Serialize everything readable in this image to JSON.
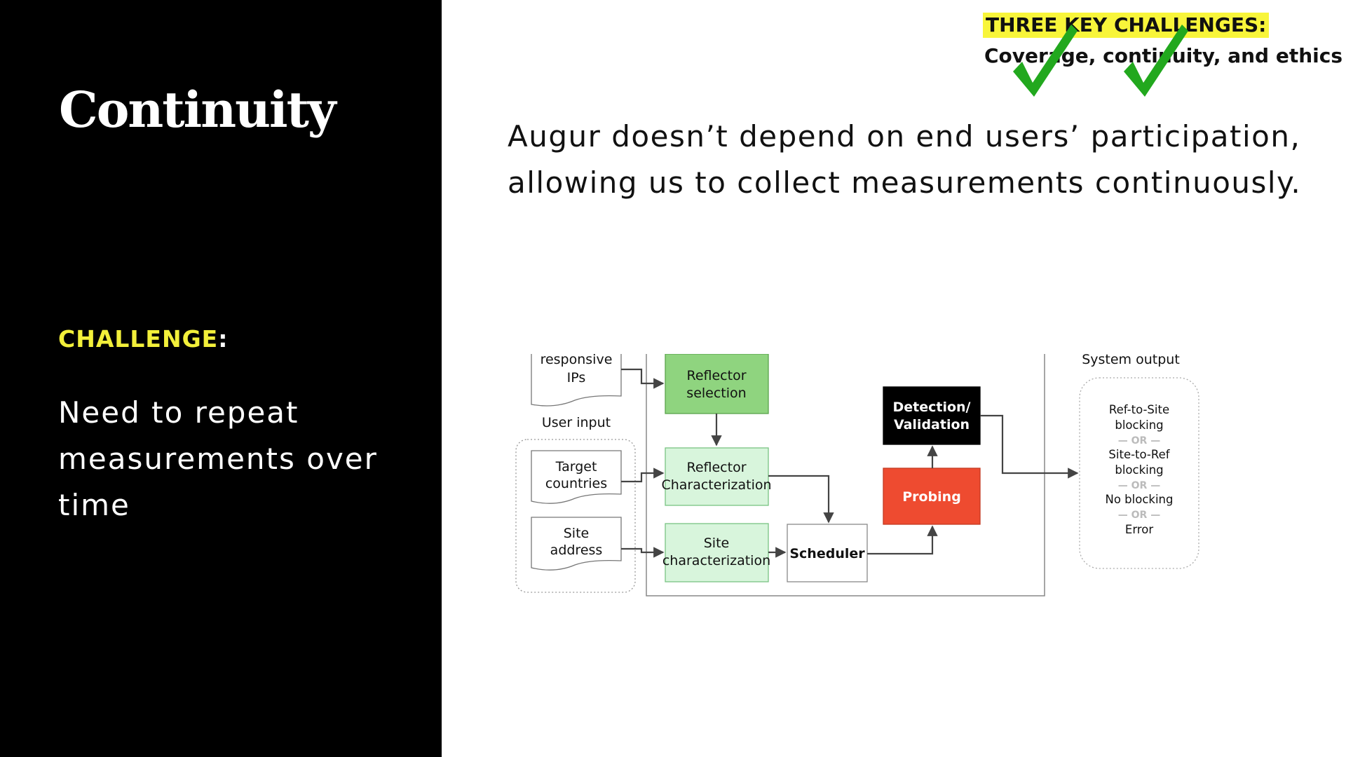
{
  "slide": {
    "title": "Continuity",
    "challenge_label": "CHALLENGE",
    "challenge_colon": ":",
    "challenge_text": "Need to repeat measurements over time",
    "key_challenges": {
      "title": "THREE KEY CHALLENGES:",
      "subtitle": "Coverage, continuity, and  ethics"
    },
    "main_text": "Augur doesn’t depend on end users’ participation, allowing us to collect measurements continuously."
  },
  "icons": {
    "check_coverage": "checkmark-icon",
    "check_continuity": "checkmark-icon"
  },
  "colors": {
    "dark_panel": "#000000",
    "challenge_accent": "#f2ef3a",
    "highlight": "#f8f53a",
    "check_green": "#22a81e",
    "reflector_selection": "#8fd47f",
    "light_green": "#d8f5dc",
    "probing": "#ee4b30",
    "detection": "#000000"
  },
  "diagram": {
    "inputs": {
      "responsive_ips_line1": "responsive",
      "responsive_ips_line2": "IPs",
      "user_input_label": "User input",
      "target_countries_line1": "Target",
      "target_countries_line2": "countries",
      "site_address_line1": "Site",
      "site_address_line2": "address"
    },
    "components": {
      "reflector_selection_line1": "Reflector",
      "reflector_selection_line2": "selection",
      "reflector_char_line1": "Reflector",
      "reflector_char_line2": "Characterization",
      "site_char_line1": "Site",
      "site_char_line2": "characterization",
      "scheduler": "Scheduler",
      "probing": "Probing",
      "detection_line1": "Detection/",
      "detection_line2": "Validation"
    },
    "output": {
      "label": "System output",
      "ref_to_site_line1": "Ref-to-Site",
      "ref_to_site_line2": "blocking",
      "or_1": "— OR —",
      "site_to_ref_line1": "Site-to-Ref",
      "site_to_ref_line2": "blocking",
      "or_2": "— OR —",
      "no_blocking": "No blocking",
      "or_3": "— OR —",
      "error": "Error"
    }
  }
}
